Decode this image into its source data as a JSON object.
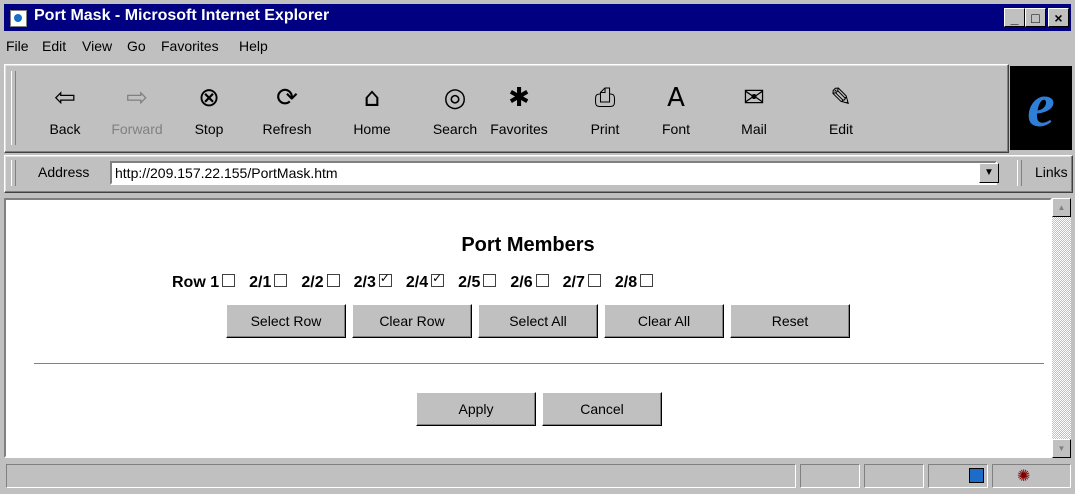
{
  "window": {
    "title": "Port Mask - Microsoft Internet Explorer",
    "controls": {
      "minimize": "_",
      "maximize": "□",
      "close": "×"
    }
  },
  "menu": [
    "File",
    "Edit",
    "View",
    "Go",
    "Favorites",
    "Help"
  ],
  "toolbar": {
    "buttons": [
      {
        "label": "Back",
        "icon": "back-arrow-icon",
        "glyph": "⇦",
        "disabled": false
      },
      {
        "label": "Forward",
        "icon": "forward-arrow-icon",
        "glyph": "⇨",
        "disabled": true
      },
      {
        "label": "Stop",
        "icon": "stop-icon",
        "glyph": "⊗",
        "disabled": false
      },
      {
        "label": "Refresh",
        "icon": "refresh-icon",
        "glyph": "⟳",
        "disabled": false
      },
      {
        "label": "Home",
        "icon": "home-icon",
        "glyph": "⌂",
        "disabled": false
      },
      {
        "label": "Search",
        "icon": "search-icon",
        "glyph": "◎",
        "disabled": false
      },
      {
        "label": "Favorites",
        "icon": "favorites-icon",
        "glyph": "✱",
        "disabled": false
      },
      {
        "label": "Print",
        "icon": "print-icon",
        "glyph": "⎙",
        "disabled": false
      },
      {
        "label": "Font",
        "icon": "font-icon",
        "glyph": "A",
        "disabled": false
      },
      {
        "label": "Mail",
        "icon": "mail-icon",
        "glyph": "✉",
        "disabled": false
      },
      {
        "label": "Edit",
        "icon": "edit-icon",
        "glyph": "✎",
        "disabled": false
      }
    ],
    "logo_glyph": "e"
  },
  "address": {
    "label": "Address",
    "value": "http://209.157.22.155/PortMask.htm",
    "links_label": "Links"
  },
  "page": {
    "heading": "Port Members",
    "ports": [
      {
        "label": "Row 1",
        "checked": false
      },
      {
        "label": "2/1",
        "checked": false
      },
      {
        "label": "2/2",
        "checked": false
      },
      {
        "label": "2/3",
        "checked": true
      },
      {
        "label": "2/4",
        "checked": true
      },
      {
        "label": "2/5",
        "checked": false
      },
      {
        "label": "2/6",
        "checked": false
      },
      {
        "label": "2/7",
        "checked": false
      },
      {
        "label": "2/8",
        "checked": false
      }
    ],
    "row_buttons": [
      "Select Row",
      "Clear Row",
      "Select All",
      "Clear All",
      "Reset"
    ],
    "action_buttons": [
      "Apply",
      "Cancel"
    ]
  },
  "colors": {
    "titlebar": "#000080",
    "chrome": "#c0c0c0"
  }
}
